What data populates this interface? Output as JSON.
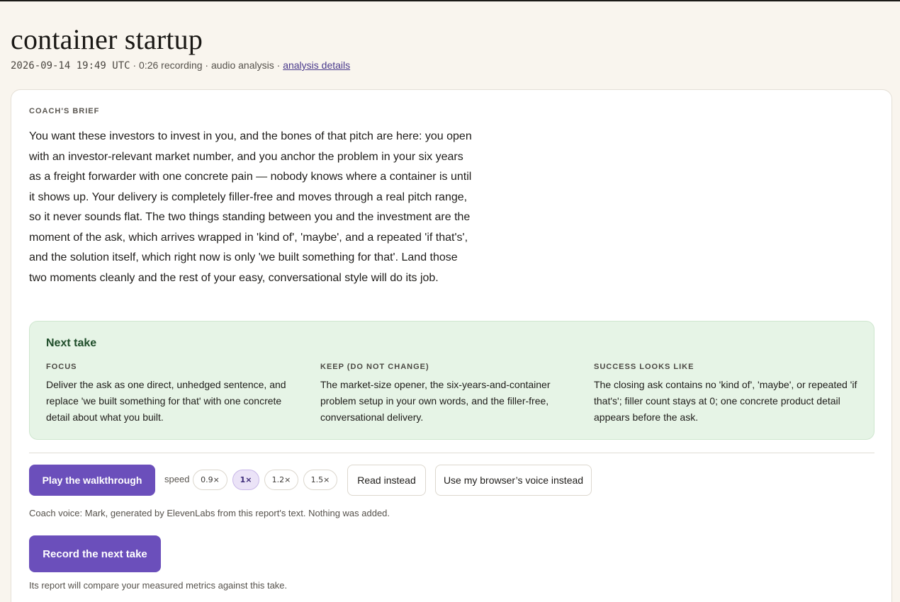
{
  "page": {
    "title": "container startup",
    "timestamp": "2026-09-14 19:49 UTC",
    "sep1": " · ",
    "duration": "0:26 recording",
    "sep2": " · ",
    "analysis_type": "audio analysis",
    "sep3": " · ",
    "details_link": "analysis details"
  },
  "brief": {
    "label": "COACH'S BRIEF",
    "text": "You want these investors to invest in you, and the bones of that pitch are here: you open with an investor-relevant market number, and you anchor the problem in your six years as a freight forwarder with one concrete pain — nobody knows where a container is until it shows up. Your delivery is completely filler-free and moves through a real pitch range, so it never sounds flat. The two things standing between you and the investment are the moment of the ask, which arrives wrapped in 'kind of', 'maybe', and a repeated 'if that's', and the solution itself, which right now is only 'we built something for that'. Land those two moments cleanly and the rest of your easy, conversational style will do its job."
  },
  "next_take": {
    "title": "Next take",
    "focus": {
      "label": "FOCUS",
      "text": "Deliver the ask as one direct, unhedged sentence, and replace 'we built something for that' with one concrete detail about what you built."
    },
    "keep": {
      "label": "KEEP (DO NOT CHANGE)",
      "text": "The market-size opener, the six-years-and-container problem setup in your own words, and the filler-free, conversational delivery."
    },
    "success": {
      "label": "SUCCESS LOOKS LIKE",
      "text": "The closing ask contains no 'kind of', 'maybe', or repeated 'if that's'; filler count stays at 0; one concrete product detail appears before the ask."
    }
  },
  "controls": {
    "play_label": "Play the walkthrough",
    "speed_label": "speed",
    "speeds": [
      "0.9×",
      "1×",
      "1.2×",
      "1.5×"
    ],
    "selected_speed": "1×",
    "read_label": "Read instead",
    "browser_voice_label": "Use my browser’s voice instead",
    "voice_note": "Coach voice: Mark, generated by ElevenLabs from this report's text. Nothing was added."
  },
  "record": {
    "label": "Record the next take",
    "note": "Its report will compare your measured metrics against this take."
  },
  "colors": {
    "accent": "#6b4fbb",
    "background": "#f9f5ee",
    "next_take_bg": "#e6f4e6",
    "next_take_title": "#1f4d2a"
  }
}
